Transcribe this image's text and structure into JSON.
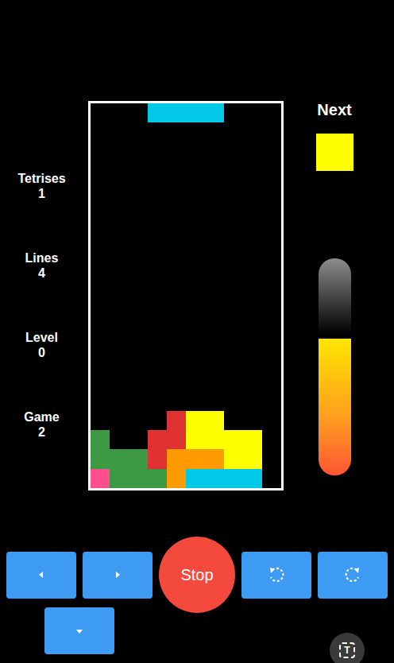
{
  "stats": [
    {
      "label": "Tetrises",
      "value": "1"
    },
    {
      "label": "Lines",
      "value": "4"
    },
    {
      "label": "Level",
      "value": "0"
    },
    {
      "label": "Game",
      "value": "2"
    }
  ],
  "board": {
    "palette": {
      "I": "#00c8e6",
      "O": "#ffff00",
      "Y": "#ffff00",
      "G": "#3d9a42",
      "R": "#e03232",
      "A": "#ff9a00",
      "P": "#ff4f8f"
    },
    "rows": [
      "...IIII...",
      "..........",
      "..........",
      "..........",
      "..........",
      "..........",
      "..........",
      "..........",
      "..........",
      "..........",
      "..........",
      "..........",
      "..........",
      "..........",
      "..........",
      "..........",
      "....RYY...",
      "G..RRYYYY.",
      "GGGRAAAYY.",
      "PGGGAIIII."
    ]
  },
  "next": {
    "label": "Next",
    "color": "#ffff00"
  },
  "meter": {
    "level": 0.63
  },
  "controls": {
    "stop": "Stop"
  },
  "overlay_button": {
    "label": "T"
  }
}
